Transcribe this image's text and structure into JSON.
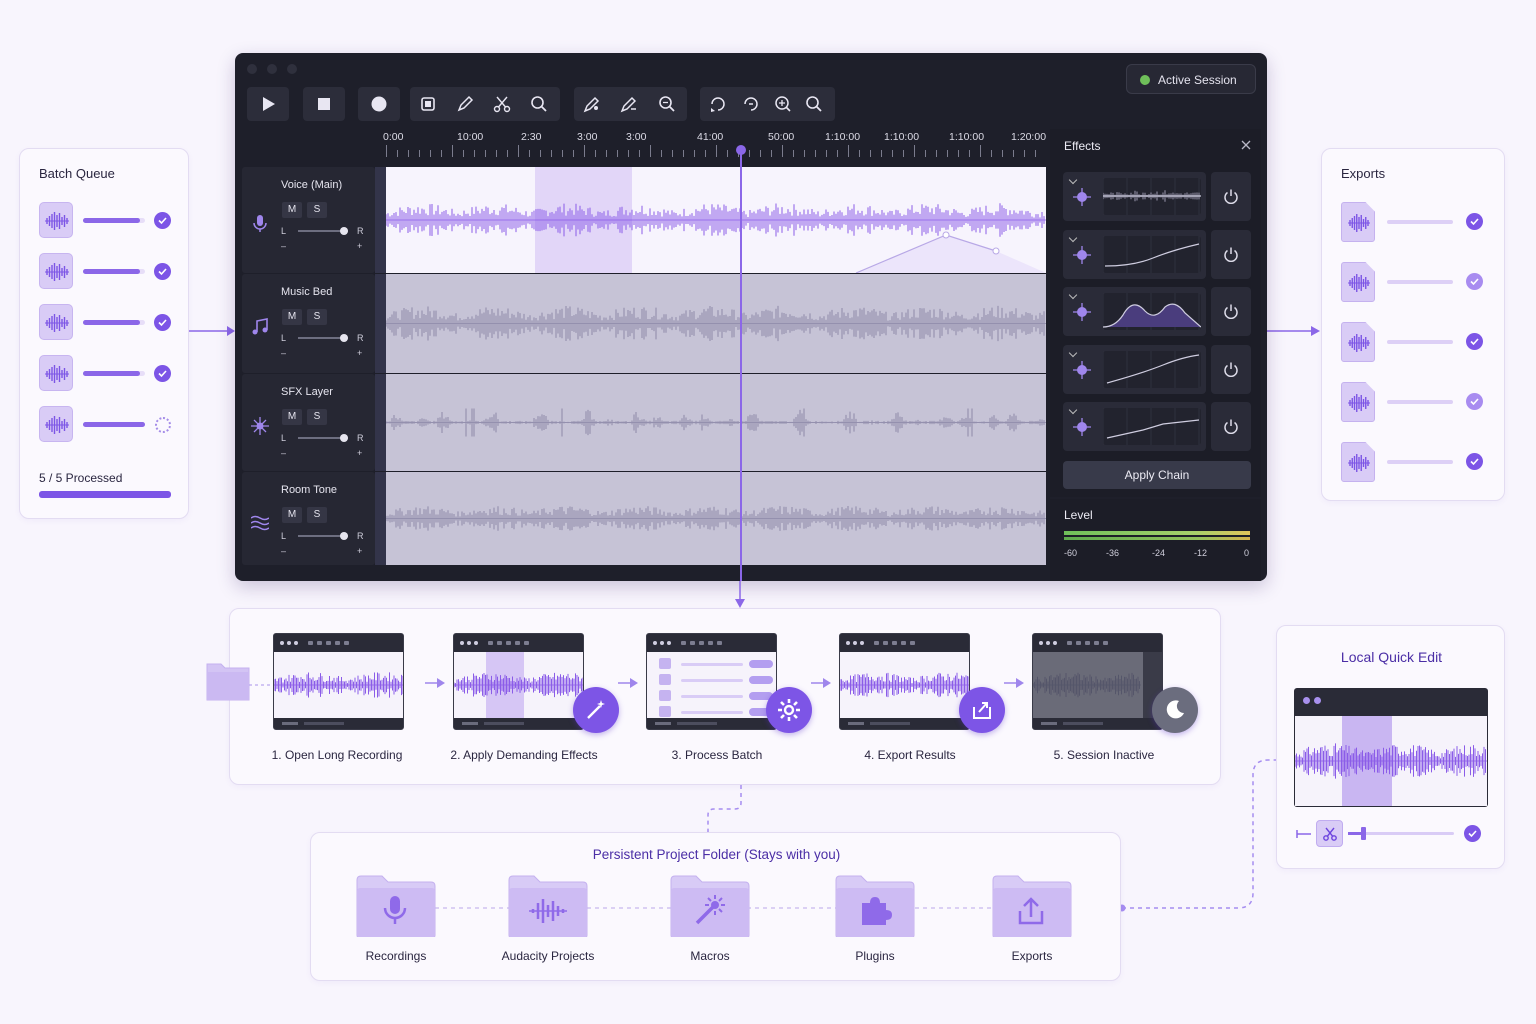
{
  "batch_queue": {
    "title": "Batch Queue",
    "items": [
      {
        "progress": 0.92,
        "status": "done"
      },
      {
        "progress": 0.92,
        "status": "done"
      },
      {
        "progress": 0.92,
        "status": "done"
      },
      {
        "progress": 0.92,
        "status": "done"
      },
      {
        "progress": 1.0,
        "status": "processing"
      }
    ],
    "summary": "5 / 5 Processed",
    "overall_progress": 1.0
  },
  "session": {
    "status": "Active Session"
  },
  "toolbar": {
    "icons": [
      "play-icon",
      "stop-icon",
      "record-icon",
      "trim-icon",
      "pencil-icon",
      "cut-icon",
      "zoom-icon",
      "draw-icon",
      "envelope-icon",
      "zoom-fit-icon",
      "loop-icon",
      "sync-icon",
      "zoom-in-icon",
      "zoom-out-icon"
    ]
  },
  "ruler": {
    "labels": [
      "0:00",
      "10:00",
      "2:30",
      "3:00",
      "3:00",
      "41:00",
      "50:00",
      "1:10:00",
      "1:10:00",
      "1:10:00",
      "1:20:00"
    ]
  },
  "tracks": [
    {
      "name": "Voice (Main)",
      "icon": "microphone-icon",
      "mute": "M",
      "solo": "S",
      "left": "L",
      "right": "R",
      "minus": "–",
      "plus": "+"
    },
    {
      "name": "Music Bed",
      "icon": "music-note-icon",
      "mute": "M",
      "solo": "S",
      "left": "L",
      "right": "R",
      "minus": "–",
      "plus": "+"
    },
    {
      "name": "SFX Layer",
      "icon": "burst-icon",
      "mute": "M",
      "solo": "S",
      "left": "L",
      "right": "R",
      "minus": "–",
      "plus": "+"
    },
    {
      "name": "Room Tone",
      "icon": "waves-icon",
      "mute": "M",
      "solo": "S",
      "left": "L",
      "right": "R",
      "minus": "–",
      "plus": "+"
    }
  ],
  "effects": {
    "title": "Effects",
    "apply_label": "Apply Chain",
    "rows": [
      "noise-reduction",
      "eq-curve",
      "compressor",
      "limiter",
      "reverb"
    ]
  },
  "level": {
    "title": "Level",
    "ticks": [
      "-60",
      "-36",
      "-24",
      "-12",
      "0"
    ]
  },
  "exports": {
    "title": "Exports",
    "items": [
      {
        "status": "done"
      },
      {
        "status": "pending"
      },
      {
        "status": "done"
      },
      {
        "status": "pending"
      },
      {
        "status": "done"
      }
    ]
  },
  "pipeline": {
    "steps": [
      {
        "label": "1. Open Long Recording"
      },
      {
        "label": "2. Apply Demanding Effects",
        "icon": "magic-wand-icon"
      },
      {
        "label": "3. Process Batch",
        "icon": "gear-icon"
      },
      {
        "label": "4. Export Results",
        "icon": "export-icon"
      },
      {
        "label": "5. Session Inactive",
        "icon": "moon-icon"
      }
    ]
  },
  "local_edit": {
    "title": "Local Quick Edit"
  },
  "project_folder": {
    "title": "Persistent Project Folder (Stays with you)",
    "folders": [
      {
        "label": "Recordings",
        "icon": "microphone-icon"
      },
      {
        "label": "Audacity Projects",
        "icon": "waveform-icon"
      },
      {
        "label": "Macros",
        "icon": "magic-wand-icon"
      },
      {
        "label": "Plugins",
        "icon": "puzzle-icon"
      },
      {
        "label": "Exports",
        "icon": "export-icon"
      }
    ]
  },
  "colors": {
    "accent": "#7c55e6",
    "accent_light": "#d9ccf6",
    "daw_bg": "#1e1f2a",
    "wave": "#8b5ce8",
    "wave_dim": "#8a86a3"
  }
}
